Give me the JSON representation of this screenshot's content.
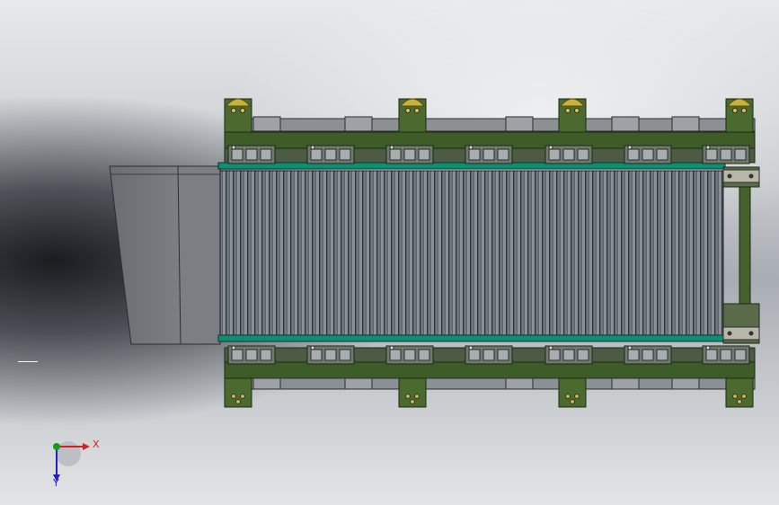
{
  "view": {
    "background": {
      "light": "#e7e9ec",
      "mid": "#a8adb3",
      "dark": "#121418"
    },
    "model": {
      "frame_color": "#3c5a25",
      "belt_color": "#5a5f66",
      "hopper_color": "#6e7277",
      "chain_color": "#0f8f72"
    }
  },
  "triad": {
    "x_label": "X",
    "y_label": "Y",
    "x_color": "#d42020",
    "y_color": "#1a9a1a",
    "z_color": "#2020c8"
  }
}
